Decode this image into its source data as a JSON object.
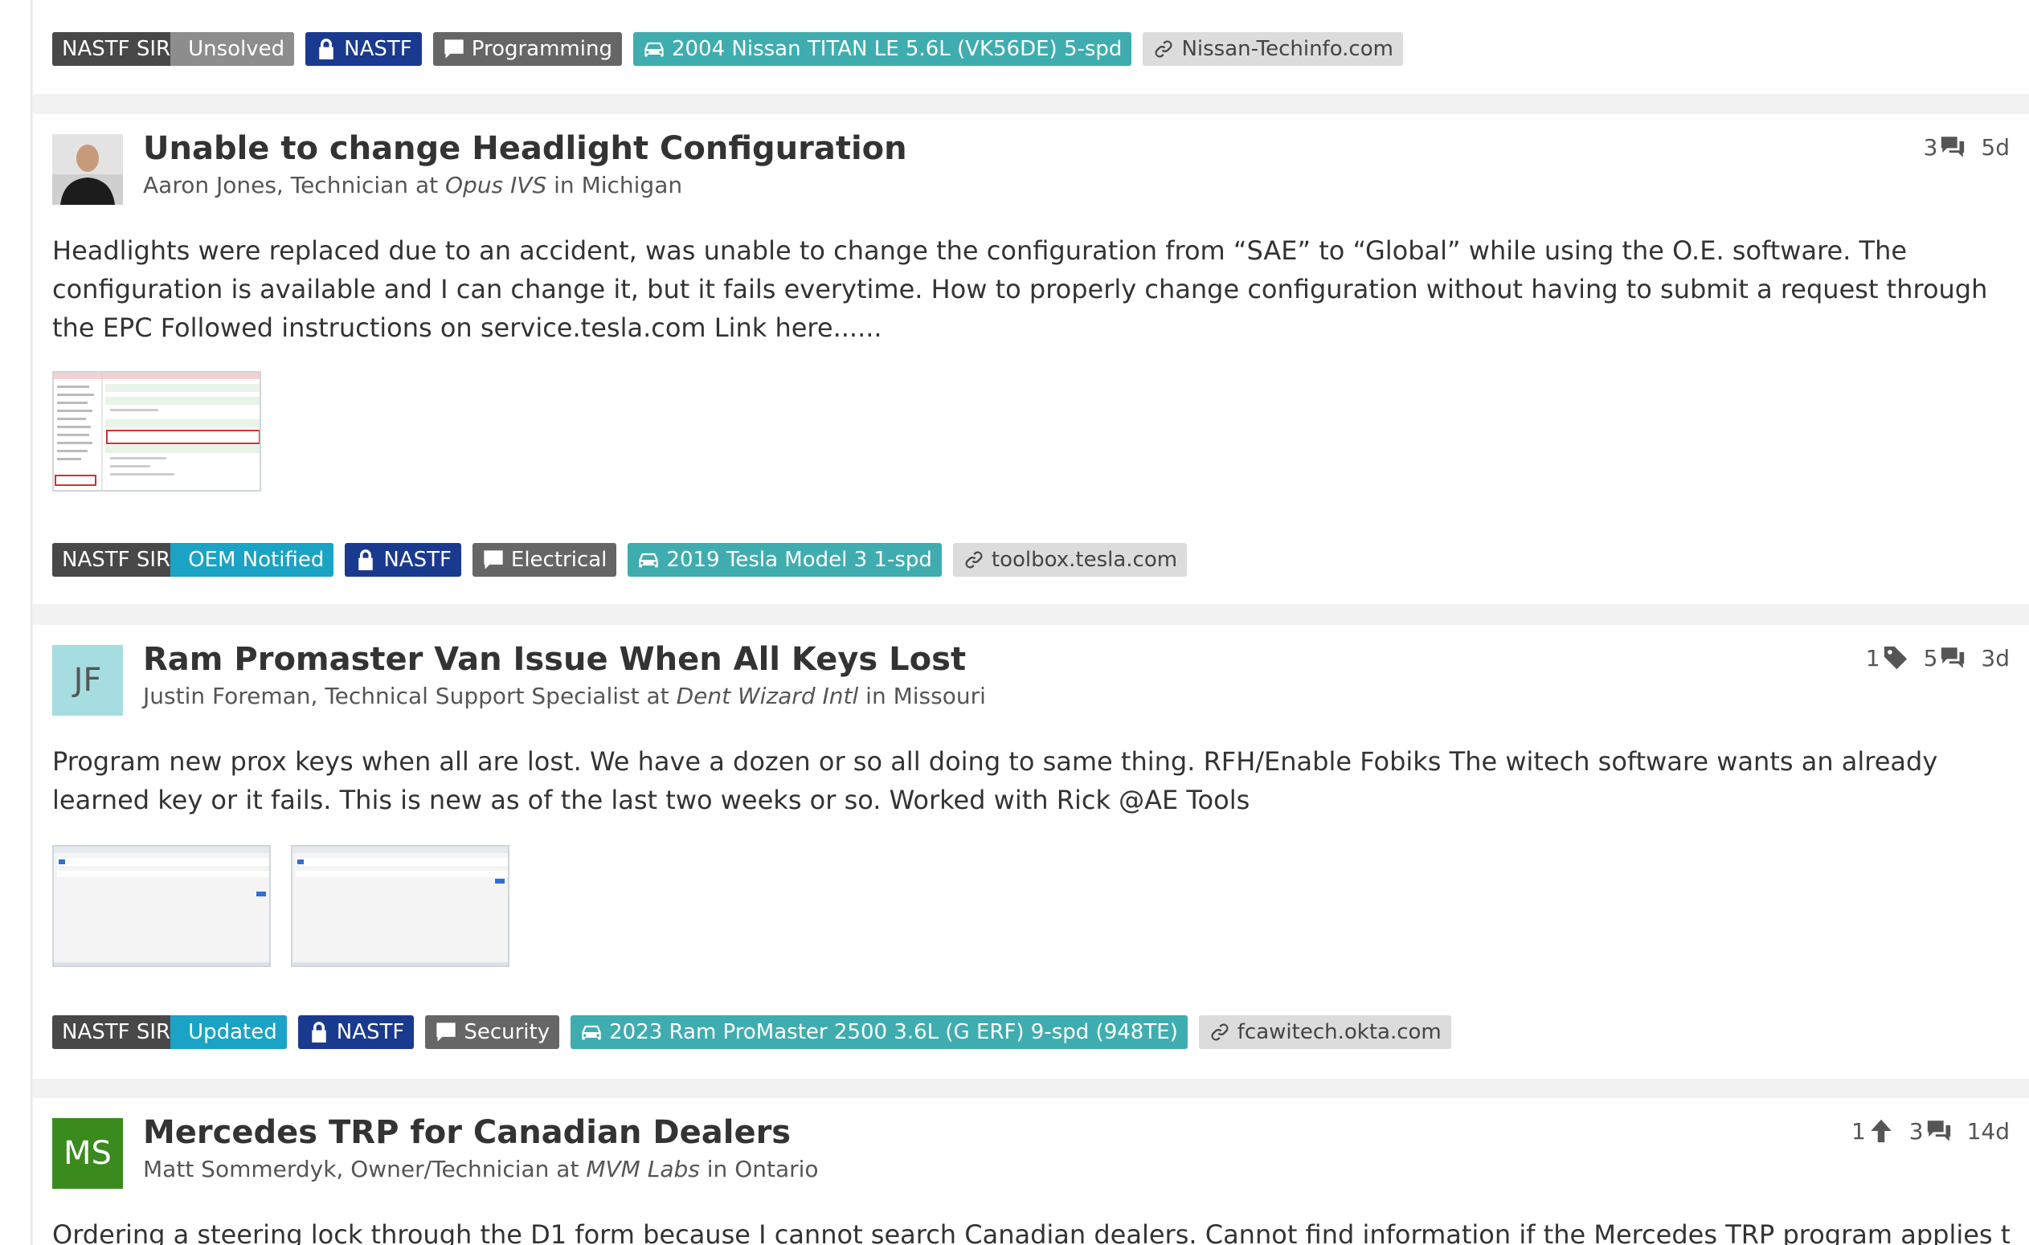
{
  "posts": [
    {
      "tags": {
        "sir_key": "NASTF SIR",
        "sir_value": "Unsolved",
        "access": "NASTF",
        "category": "Programming",
        "vehicle": "2004 Nissan TITAN LE 5.6L (VK56DE) 5-spd",
        "link": "Nissan-Techinfo.com"
      }
    },
    {
      "title": "Unable to change Headlight Configuration",
      "author": "Aaron Jones, Technician at",
      "company": "Opus IVS",
      "location": "in Michigan",
      "avatar": "photo",
      "comments": "3",
      "age": "5d",
      "body": "Headlights were replaced due to an accident, was unable to change the configuration from “SAE” to “Global” while using the O.E. software. The configuration is available and I can change it, but it fails everytime. How to properly change configuration without having to submit a request through the EPC Followed instructions on service.tesla.com Link here......",
      "tags": {
        "sir_key": "NASTF SIR",
        "sir_value": "OEM Notified",
        "access": "NASTF",
        "category": "Electrical",
        "vehicle": "2019 Tesla Model 3 1-spd",
        "link": "toolbox.tesla.com"
      }
    },
    {
      "title": "Ram Promaster Van Issue When All Keys Lost",
      "author": "Justin Foreman, Technical Support Specialist at",
      "company": "Dent Wizard Intl",
      "location": "in Missouri",
      "avatar": "JF",
      "avatar_bg": "#a6dde0",
      "tags_count": "1",
      "comments": "5",
      "age": "3d",
      "body": "Program new prox keys when all are lost. We have a dozen or so all doing to same thing. RFH/Enable Fobiks The witech software wants an already learned key or it fails. This is new as of the last two weeks or so. Worked with Rick @AE Tools",
      "tags": {
        "sir_key": "NASTF SIR",
        "sir_value": "Updated",
        "access": "NASTF",
        "category": "Security",
        "vehicle": "2023 Ram ProMaster 2500 3.6L (G ERF) 9-spd (948TE)",
        "link": "fcawitech.okta.com"
      }
    },
    {
      "title": "Mercedes TRP for Canadian Dealers",
      "author": "Matt Sommerdyk, Owner/Technician at",
      "company": "MVM Labs",
      "location": "in Ontario",
      "avatar": "MS",
      "avatar_bg": "#3a8a1e",
      "upvotes": "1",
      "comments": "3",
      "age": "14d",
      "body": "Ordering a steering lock through the D1 form because I cannot search Canadian dealers. Cannot find information if the Mercedes TRP program applies to Canada"
    }
  ],
  "colors": {
    "nastf": "#1a3a8f",
    "vehicle": "#3fadb0",
    "sir_status_blue": "#1aa3c4"
  }
}
